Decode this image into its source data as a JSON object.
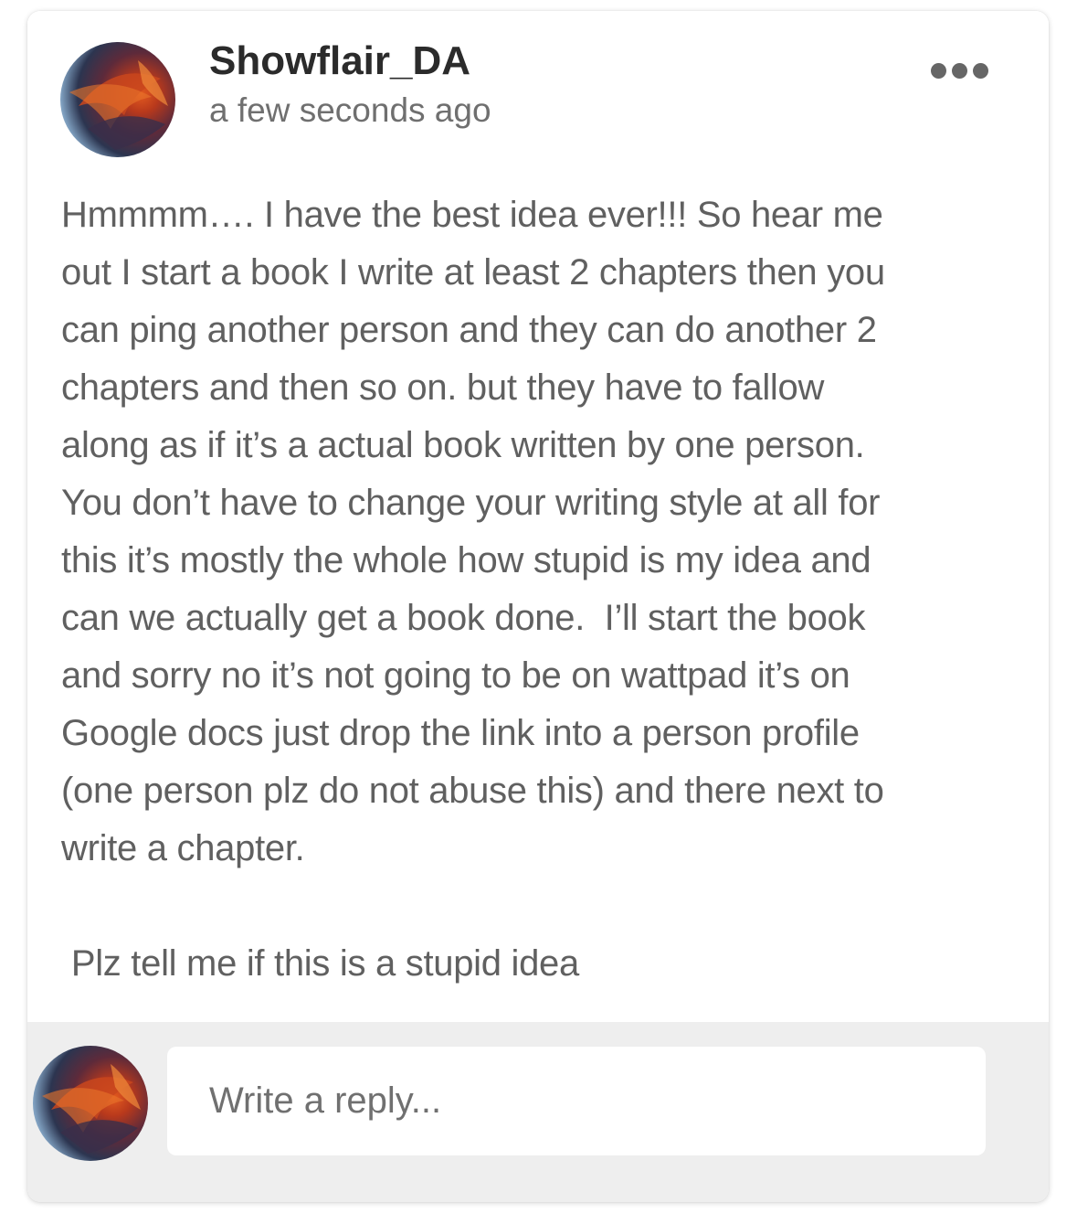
{
  "post": {
    "author": "Showflair_DA",
    "timestamp": "a few seconds ago",
    "more_icon": "more-horizontal-icon",
    "body": "Hmmmm…. I have the best idea ever!!! So hear me\nout I start a book I write at least 2 chapters then you\ncan ping another person and they can do another 2\nchapters and then so on. but they have to fallow\nalong as if it’s a actual book written by one person.\nYou don’t have to change your writing style at all for\nthis it’s mostly the whole how stupid is my idea and\ncan we actually get a book done.  I’ll start the book\nand sorry no it’s not going to be on wattpad it’s on\nGoogle docs just drop the link into a person profile\n(one person plz do not abuse this) and there next to\nwrite a chapter.\n\n Plz tell me if this is a stupid idea"
  },
  "reply": {
    "placeholder": "Write a reply...",
    "value": ""
  },
  "colors": {
    "username": "#2b2b2b",
    "timestamp": "#6f6f6f",
    "body_text": "#606060",
    "footer_bg": "#eeeeee",
    "more_dots": "#666666"
  }
}
